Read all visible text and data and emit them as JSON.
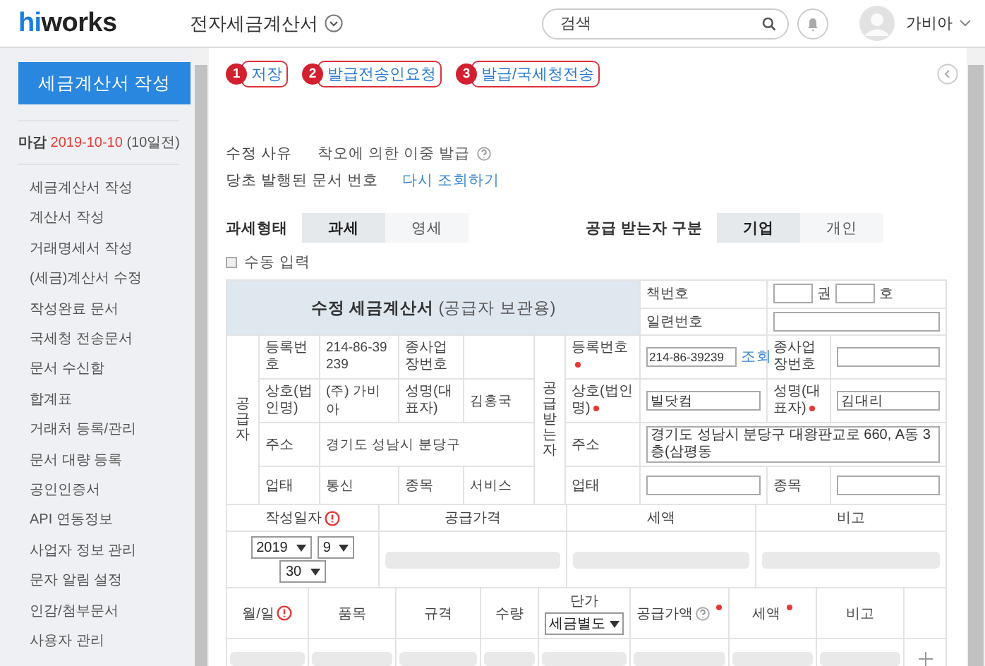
{
  "header": {
    "logo_accent": "hi",
    "logo_rest": "works",
    "app_title": "전자세금계산서",
    "search": {
      "placeholder": "검색"
    },
    "user_name": "가비아"
  },
  "sidebar": {
    "compose_button": "세금계산서 작성",
    "deadline": {
      "label": "마감",
      "date": "2019-10-10",
      "remaining": "(10일전)"
    },
    "items": [
      "세금계산서 작성",
      "계산서 작성",
      "거래명세서 작성",
      "(세금)계산서 수정",
      "작성완료 문서",
      "국세청 전송문서",
      "문서 수신함",
      "합계표",
      "거래처 등록/관리",
      "문서 대량 등록",
      "공인인증서",
      "API 연동정보",
      "사업자 정보 관리",
      "문자 알림 설정",
      "인감/첨부문서",
      "사용자 관리"
    ]
  },
  "toolbar": [
    {
      "number": "1",
      "label": "저장"
    },
    {
      "number": "2",
      "label": "발급전송인요청"
    },
    {
      "number": "3",
      "label": "발급/국세청전송"
    }
  ],
  "revision": {
    "reason_label": "수정 사유",
    "reason": "착오에 의한 이중 발급",
    "reason_help": true,
    "original_label": "당초 발행된 문서 번호",
    "lookup_link": "다시 조회하기"
  },
  "tax_type": {
    "label": "과세형태",
    "options": [
      {
        "label": "과세",
        "selected": true
      },
      {
        "label": "영세",
        "selected": false
      }
    ]
  },
  "recipient_type": {
    "label": "공급 받는자 구분",
    "options": [
      {
        "label": "기업",
        "selected": true
      },
      {
        "label": "개인",
        "selected": false
      }
    ]
  },
  "manual_input": {
    "label": "수동 입력",
    "checked": false
  },
  "invoice": {
    "title": "수정 세금계산서",
    "subtitle": "(공급자 보관용)",
    "book_label": "책번호",
    "book_unit_1": "권",
    "book_unit_2": "호",
    "serial_label": "일련번호",
    "supplier": {
      "label": "공급자",
      "reg_label": "등록번호",
      "reg_value": "214-86-39239",
      "branch_label": "종사업장번호",
      "name_label": "상호(법인명)",
      "name_value": "(주) 가비아",
      "ceo_label": "성명(대표자)",
      "ceo_value": "김홍국",
      "address_label": "주소",
      "address_value": "경기도 성남시 분당구",
      "business_label": "업태",
      "business_value": "통신",
      "item_label": "종목",
      "item_value": "서비스"
    },
    "recipient": {
      "label": "공급받는자",
      "reg_label": "등록번호",
      "reg_required": true,
      "reg_value": "214-86-39239",
      "lookup": "조회",
      "branch_label": "종사업장번호",
      "name_label": "상호(법인명)",
      "name_required": true,
      "name_value": "빌닷컴",
      "ceo_label": "성명(대표자)",
      "ceo_required": true,
      "ceo_value": "김대리",
      "address_label": "주소",
      "address_value": "경기도 성남시 분당구 대왕판교로 660, A동 3층(삼평동",
      "business_label": "업태",
      "item_label": "종목"
    }
  },
  "summary": {
    "columns": [
      {
        "label": "작성일자",
        "alert": true
      },
      {
        "label": "공급가격",
        "alert": false
      },
      {
        "label": "세액",
        "alert": false
      },
      {
        "label": "비고",
        "alert": false
      }
    ],
    "year": "2019",
    "month": "9",
    "day": "30"
  },
  "items": {
    "columns": [
      {
        "label": "월/일",
        "alert": true,
        "help": false,
        "required": false
      },
      {
        "label": "품목",
        "alert": false,
        "help": false,
        "required": false
      },
      {
        "label": "규격",
        "alert": false,
        "help": false,
        "required": false
      },
      {
        "label": "수량",
        "alert": false,
        "help": false,
        "required": false
      },
      {
        "label": "단가",
        "alert": false,
        "help": false,
        "required": false
      },
      {
        "label": "공급가액",
        "alert": false,
        "help": true,
        "required": true
      },
      {
        "label": "세액",
        "alert": false,
        "help": false,
        "required": true
      },
      {
        "label": "비고",
        "alert": false,
        "help": false,
        "required": false
      }
    ],
    "price_mode": "세금별도"
  }
}
